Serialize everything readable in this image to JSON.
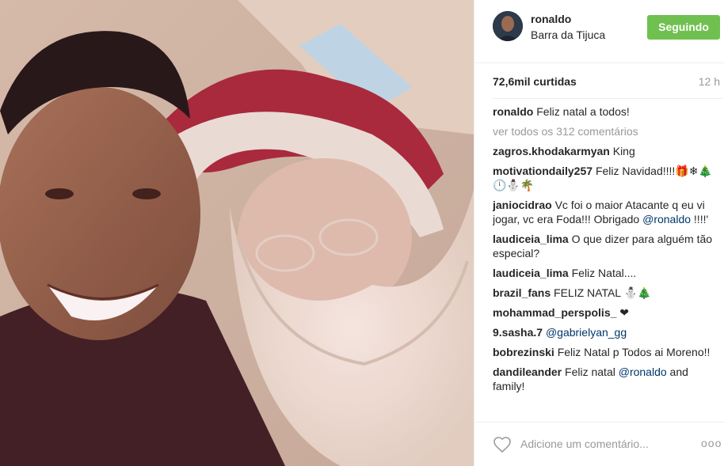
{
  "post": {
    "username": "ronaldo",
    "location": "Barra da Tijuca",
    "follow_label": "Seguindo",
    "likes": "72,6mil curtidas",
    "time": "12 h",
    "caption_user": "ronaldo",
    "caption_text": "Feliz natal a todos!",
    "view_all": "ver todos os 312 comentários"
  },
  "comments": [
    {
      "user": "zagros.khodakarmyan",
      "text": "King"
    },
    {
      "user": "motivationdaily257",
      "text": "Feliz Navidad!!!!🎁❄🎄🕛⛄🌴"
    },
    {
      "user": "janiocidrao",
      "text": "Vc foi o maior Atacante q eu vi jogar, vc era Foda!!! Obrigado",
      "mention": "@ronaldo",
      "after": " !!!!'"
    },
    {
      "user": "laudiceia_lima",
      "text": "O que dizer para alguém tão especial?"
    },
    {
      "user": "laudiceia_lima",
      "text": "Feliz Natal...."
    },
    {
      "user": "brazil_fans",
      "text": "FELIZ NATAL ⛄🎄"
    },
    {
      "user": "mohammad_perspolis_",
      "text": "❤"
    },
    {
      "user": "9.sasha.7",
      "text": "",
      "mention": "@gabrielyan_gg",
      "after": ""
    },
    {
      "user": "bobrezinski",
      "text": "Feliz Natal p Todos ai Moreno!!"
    },
    {
      "user": "dandileander",
      "text": "Feliz natal",
      "mention": "@ronaldo",
      "after": " and family!"
    }
  ],
  "footer": {
    "add_comment_placeholder": "Adicione um comentário...",
    "more_label": "ooo"
  },
  "icons": {
    "heart": "heart-icon",
    "more": "more-options-icon"
  },
  "colors": {
    "follow_button": "#70c050",
    "mention": "#003569",
    "muted": "#999999"
  }
}
